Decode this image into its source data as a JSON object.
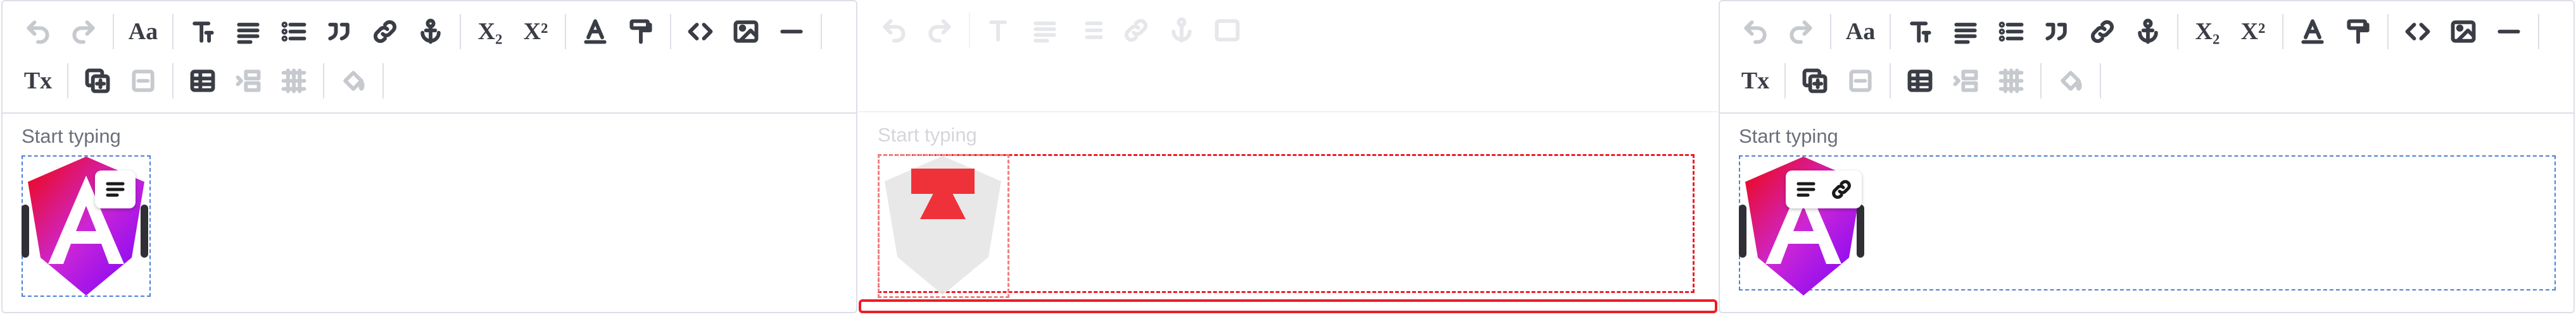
{
  "editor": {
    "placeholder": "Start typing",
    "toolbar": {
      "heading_label": "Aa",
      "subscript_label": "X₂",
      "superscript_label": "X²",
      "clear_format_label": "Tx"
    }
  },
  "colors": {
    "border": "#dcdfe6",
    "icon": "#3a3d45",
    "disabled_icon": "#c6c9ce",
    "selection_blue": "#4b7fd6",
    "selection_red": "#ee1b24"
  },
  "icons": [
    "undo-icon",
    "redo-icon",
    "font-size-icon",
    "text-style-icon",
    "align-icon",
    "bullet-list-icon",
    "blockquote-icon",
    "link-icon",
    "anchor-icon",
    "subscript-icon",
    "superscript-icon",
    "font-color-icon",
    "format-painter-icon",
    "code-icon",
    "image-icon",
    "horizontal-rule-icon",
    "clear-format-icon",
    "add-block-icon",
    "remove-block-icon",
    "table-icon",
    "indent-icon",
    "table-grid-icon",
    "fill-color-icon"
  ]
}
